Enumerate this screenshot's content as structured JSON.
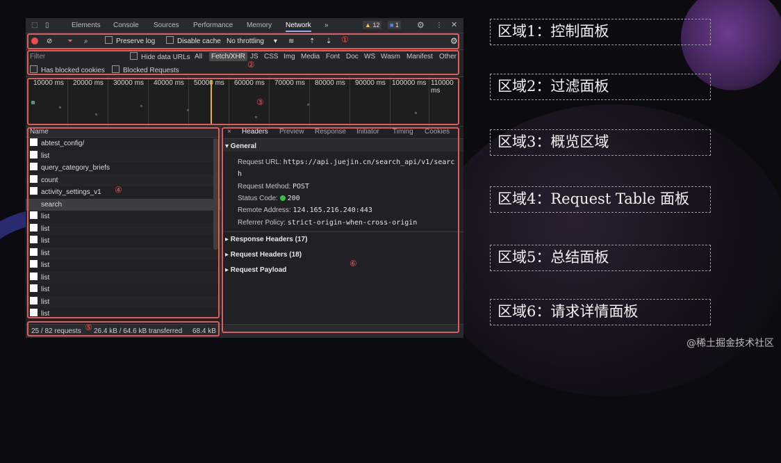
{
  "tabs": [
    "Elements",
    "Console",
    "Sources",
    "Performance",
    "Memory",
    "Network",
    "»"
  ],
  "badges": {
    "warnings": "12",
    "messages": "1"
  },
  "toolbar": {
    "preserve_log": "Preserve log",
    "disable_cache": "Disable cache",
    "throttling": "No throttling"
  },
  "filter": {
    "placeholder": "Filter",
    "hide_data_urls": "Hide data URLs",
    "types": [
      "All",
      "Fetch/XHR",
      "JS",
      "CSS",
      "Img",
      "Media",
      "Font",
      "Doc",
      "WS",
      "Wasm",
      "Manifest",
      "Other"
    ],
    "has_blocked_cookies": "Has blocked cookies",
    "blocked_requests": "Blocked Requests"
  },
  "overview": {
    "ticks": [
      "10000 ms",
      "20000 ms",
      "30000 ms",
      "40000 ms",
      "50000 ms",
      "60000 ms",
      "70000 ms",
      "80000 ms",
      "90000 ms",
      "100000 ms",
      "110000 ms"
    ]
  },
  "request_table": {
    "header": "Name",
    "rows": [
      "abtest_config/",
      "list",
      "query_category_briefs",
      "count",
      "activity_settings_v1",
      "search",
      "list",
      "list",
      "list",
      "list",
      "list",
      "list",
      "list",
      "list",
      "list"
    ],
    "selected_row": "search"
  },
  "summary": {
    "requests": "25 / 82 requests",
    "transferred": "26.4 kB / 64.6 kB transferred",
    "resources": "68.4 kB"
  },
  "details": {
    "close": "×",
    "tabs": [
      "Headers",
      "Preview",
      "Response",
      "Initiator",
      "Timing",
      "Cookies"
    ],
    "general_title": "▾ General",
    "request_url_label": "Request URL:",
    "request_url_line1": "https://api.juejin.cn/search_api/v1/searc",
    "request_url_line2": "h",
    "request_method_label": "Request Method:",
    "request_method": "POST",
    "status_code_label": "Status Code:",
    "status_code": "200",
    "remote_address_label": "Remote Address:",
    "remote_address": "124.165.216.240:443",
    "referrer_policy_label": "Referrer Policy:",
    "referrer_policy": "strict-origin-when-cross-origin",
    "response_headers": "▸ Response Headers (17)",
    "request_headers": "▸ Request Headers (18)",
    "request_payload": "▸ Request Payload"
  },
  "region_numbers": [
    "①",
    "②",
    "③",
    "④",
    "⑤",
    "⑥"
  ],
  "regions": [
    "区域1：控制面板",
    "区域2：过滤面板",
    "区域3：概览区域",
    "区域4：Request Table 面板",
    "区域5：总结面板",
    "区域6：请求详情面板"
  ],
  "watermark": "@稀土掘金技术社区",
  "colors": {
    "highlight_box": "#e25b5b",
    "timeline_marker": "#e6b422",
    "status_ok": "#31c14a"
  }
}
